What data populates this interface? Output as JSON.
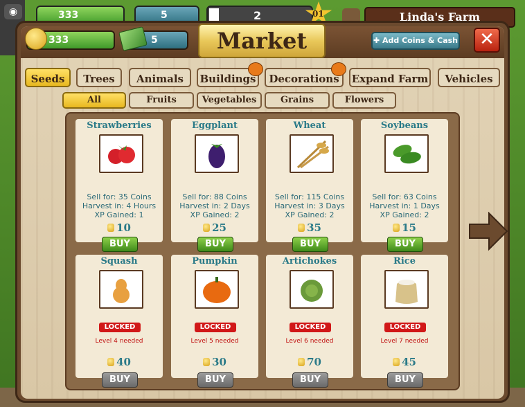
{
  "hud": {
    "coins": "333",
    "cash": "5",
    "level": "2",
    "star_level": "01",
    "farm_name": "Linda's Farm"
  },
  "market": {
    "title": "Market",
    "coins": "333",
    "cash": "5",
    "add_button": "Add Coins & Cash",
    "close_label": "✕"
  },
  "tabs": [
    {
      "label": "Seeds"
    },
    {
      "label": "Trees"
    },
    {
      "label": "Animals"
    },
    {
      "label": "Buildings"
    },
    {
      "label": "Decorations"
    },
    {
      "label": "Expand Farm"
    },
    {
      "label": "Vehicles"
    }
  ],
  "subtabs": [
    {
      "label": "All"
    },
    {
      "label": "Fruits"
    },
    {
      "label": "Vegetables"
    },
    {
      "label": "Grains"
    },
    {
      "label": "Flowers"
    }
  ],
  "items": [
    {
      "name": "Strawberries",
      "sell": "Sell for: 35 Coins",
      "harvest": "Harvest in: 4 Hours",
      "xp": "XP Gained: 1",
      "price": "10",
      "buy": "BUY",
      "icon": "strawberry"
    },
    {
      "name": "Eggplant",
      "sell": "Sell for: 88 Coins",
      "harvest": "Harvest in: 2 Days",
      "xp": "XP Gained: 2",
      "price": "25",
      "buy": "BUY",
      "icon": "eggplant"
    },
    {
      "name": "Wheat",
      "sell": "Sell for: 115 Coins",
      "harvest": "Harvest in: 3 Days",
      "xp": "XP Gained: 2",
      "price": "35",
      "buy": "BUY",
      "icon": "wheat"
    },
    {
      "name": "Soybeans",
      "sell": "Sell for: 63 Coins",
      "harvest": "Harvest in: 1 Days",
      "xp": "XP Gained: 2",
      "price": "15",
      "buy": "BUY",
      "icon": "soybean"
    },
    {
      "name": "Squash",
      "locked": "LOCKED",
      "needed": "Level 4 needed",
      "price": "40",
      "buy": "BUY",
      "icon": "squash"
    },
    {
      "name": "Pumpkin",
      "locked": "LOCKED",
      "needed": "Level 5 needed",
      "price": "30",
      "buy": "BUY",
      "icon": "pumpkin"
    },
    {
      "name": "Artichokes",
      "locked": "LOCKED",
      "needed": "Level 6 needed",
      "price": "70",
      "buy": "BUY",
      "icon": "artichoke"
    },
    {
      "name": "Rice",
      "locked": "LOCKED",
      "needed": "Level 7 needed",
      "price": "45",
      "buy": "BUY",
      "icon": "rice"
    }
  ],
  "colors": {
    "accent_gold": "#e8b820",
    "buy_green": "#3e8a1a",
    "locked_red": "#d11818",
    "item_text": "#2a7a88"
  }
}
